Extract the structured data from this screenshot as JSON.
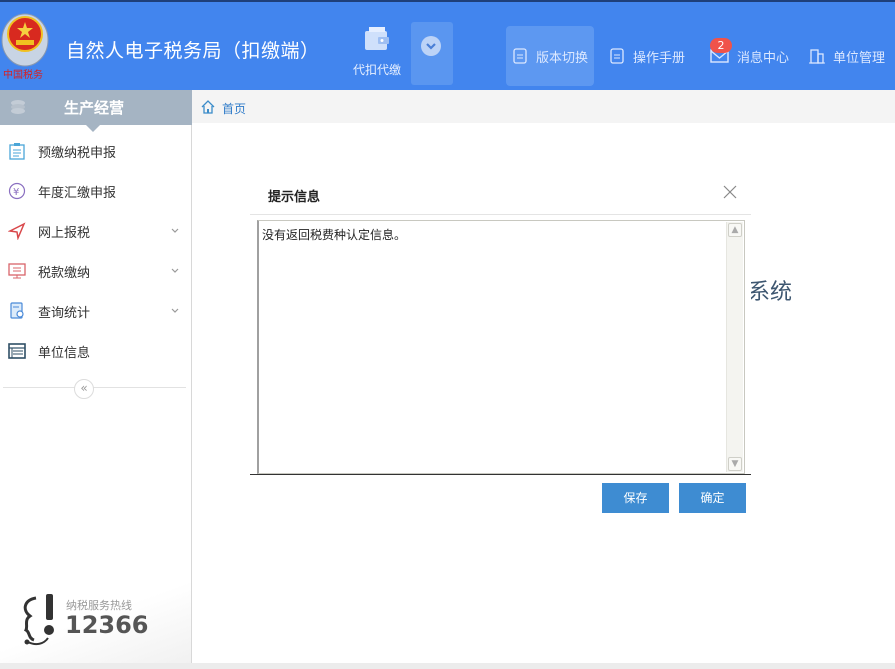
{
  "header": {
    "app_title": "自然人电子税务局（扣缴端）",
    "logo_caption": "中国税务",
    "daikou_label": "代扣代缴",
    "nav": [
      {
        "label": "版本切换",
        "icon": "document-icon",
        "active": true
      },
      {
        "label": "操作手册",
        "icon": "document-icon",
        "active": false
      },
      {
        "label": "消息中心",
        "icon": "mail-icon",
        "active": false,
        "badge": "2"
      },
      {
        "label": "单位管理",
        "icon": "building-icon",
        "active": false
      }
    ]
  },
  "sidebar": {
    "section_title": "生产经营",
    "items": [
      {
        "label": "预缴纳税申报",
        "icon": "clipboard-icon",
        "expandable": false
      },
      {
        "label": "年度汇缴申报",
        "icon": "yen-circle-icon",
        "expandable": false
      },
      {
        "label": "网上报税",
        "icon": "send-icon",
        "expandable": true
      },
      {
        "label": "税款缴纳",
        "icon": "monitor-icon",
        "expandable": true
      },
      {
        "label": "查询统计",
        "icon": "search-doc-icon",
        "expandable": true
      },
      {
        "label": "单位信息",
        "icon": "list-icon",
        "expandable": false
      }
    ],
    "collapse_symbol": "«",
    "hotline_label": "纳税服务热线",
    "hotline_number": "12366"
  },
  "breadcrumb": {
    "home": "首页"
  },
  "background_text": "系统",
  "dialog": {
    "title": "提示信息",
    "message": "没有返回税费种认定信息。",
    "buttons": {
      "save": "保存",
      "confirm": "确定"
    }
  },
  "colors": {
    "header_bg": "#4285ee",
    "badge": "#f0534a",
    "button": "#3e8cd2",
    "sidebar_header": "#a5b4c3"
  }
}
